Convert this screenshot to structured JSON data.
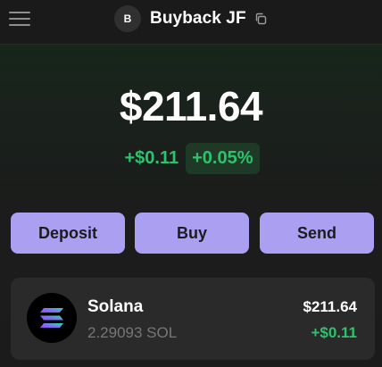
{
  "header": {
    "account_initial": "B",
    "account_name": "Buyback JF",
    "icons": {
      "menu": "hamburger-menu-icon",
      "copy": "copy-icon"
    }
  },
  "balance": {
    "total": "$211.64",
    "change_abs": "+$0.11",
    "change_pct": "+0.05%"
  },
  "actions": {
    "deposit_label": "Deposit",
    "buy_label": "Buy",
    "send_label": "Send"
  },
  "tokens": [
    {
      "name": "Solana",
      "amount": "2.29093 SOL",
      "value": "$211.64",
      "change": "+$0.11",
      "icon": "solana-logo-icon"
    }
  ],
  "colors": {
    "accent_button": "#ab9ff2",
    "positive": "#2ec26d",
    "positive_bg": "#1e3a26",
    "background": "#1b1b1b",
    "card": "#2a2a2a"
  }
}
